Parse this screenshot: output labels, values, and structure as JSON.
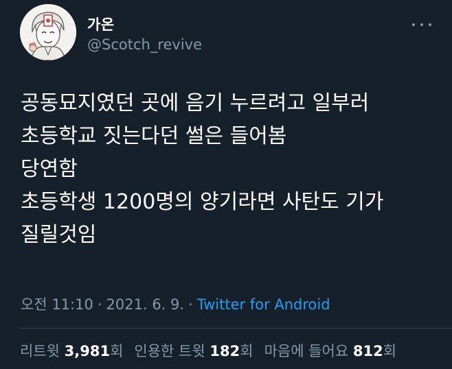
{
  "author": {
    "display_name": "가온",
    "handle": "@Scotch_revive",
    "avatar_icon": "illustrated-character-avatar"
  },
  "tweet": {
    "lines": [
      "공동묘지였던 곳에 음기 누르려고 일부러",
      "초등학교 짓는다던 썰은 들어봄",
      "당연함",
      "초등학생 1200명의 양기라면 사탄도 기가",
      "질릴것임"
    ]
  },
  "meta": {
    "time": "오전 11:10",
    "separator": "·",
    "date": "2021. 6. 9.",
    "source": "Twitter for Android"
  },
  "stats": {
    "retweets": {
      "label": "리트윗",
      "count": "3,981",
      "unit": "회"
    },
    "quotes": {
      "label": "인용한 트윗",
      "count": "182",
      "unit": "회"
    },
    "likes": {
      "label": "마음에 들어요",
      "count": "812",
      "unit": "회"
    }
  },
  "colors": {
    "background": "#15202b",
    "text": "#ffffff",
    "secondary": "#8899a6",
    "link": "#1da1f2",
    "divider": "#38444d"
  }
}
